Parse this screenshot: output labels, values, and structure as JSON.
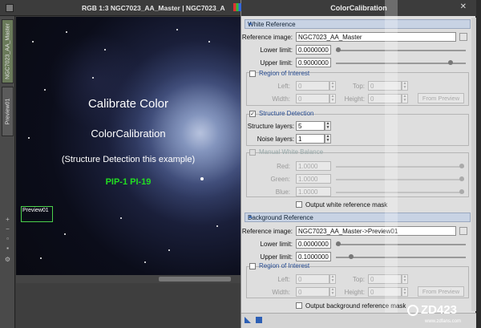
{
  "image_window": {
    "title": "RGB 1:3 NGC7023_AA_Master | NGC7023_A",
    "side_tabs": [
      "NGC7023_AA_Master",
      "Preview01"
    ],
    "overlay_lines": [
      "Calibrate Color",
      "ColorCalibration",
      "(Structure Detection this example)",
      "PIP-1 PI-19"
    ],
    "preview_label": "Preview01"
  },
  "dialog": {
    "title": "ColorCalibration",
    "white_reference": {
      "header": "White Reference",
      "reference_image_label": "Reference image:",
      "reference_image_value": "NGC7023_AA_Master",
      "lower_limit_label": "Lower limit:",
      "lower_limit_value": "0.0000000",
      "lower_limit_fraction": 0.0,
      "upper_limit_label": "Upper limit:",
      "upper_limit_value": "0.9000000",
      "upper_limit_fraction": 0.9,
      "roi": {
        "title": "Region of Interest",
        "left_label": "Left:",
        "left_value": "0",
        "top_label": "Top:",
        "top_value": "0",
        "width_label": "Width:",
        "width_value": "0",
        "height_label": "Height:",
        "height_value": "0",
        "from_preview": "From Preview"
      },
      "structure": {
        "title": "Structure Detection",
        "checked": true,
        "structure_layers_label": "Structure layers:",
        "structure_layers_value": "5",
        "noise_layers_label": "Noise layers:",
        "noise_layers_value": "1"
      },
      "manual": {
        "title": "Manual White Balance",
        "red_label": "Red:",
        "red_value": "1.0000",
        "green_label": "Green:",
        "green_value": "1.0000",
        "blue_label": "Blue:",
        "blue_value": "1.0000"
      },
      "output_mask": "Output white reference mask"
    },
    "background_reference": {
      "header": "Background Reference",
      "reference_image_label": "Reference image:",
      "reference_image_value": "NGC7023_AA_Master->Preview01",
      "lower_limit_label": "Lower limit:",
      "lower_limit_value": "0.0000000",
      "lower_limit_fraction": 0.0,
      "upper_limit_label": "Upper limit:",
      "upper_limit_value": "0.1000000",
      "upper_limit_fraction": 0.1,
      "roi": {
        "title": "Region of Interest",
        "left_label": "Left:",
        "left_value": "0",
        "top_label": "Top:",
        "top_value": "0",
        "width_label": "Width:",
        "width_value": "0",
        "height_label": "Height:",
        "height_value": "0",
        "from_preview": "From Preview"
      },
      "output_mask": "Output background reference mask"
    }
  },
  "watermark": {
    "big": "ZD423",
    "small": "www.zdfans.com"
  },
  "colors": {
    "green_text": "#22dd22",
    "section_blue": "#2a4f95",
    "title_bar": "#3c3c3c"
  }
}
